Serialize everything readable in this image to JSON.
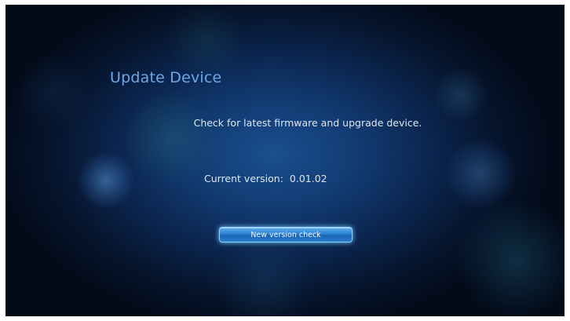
{
  "screen": {
    "title": "Update Device",
    "description": "Check for latest firmware and upgrade device.",
    "version_label": "Current version:",
    "version_value": "0.01.02",
    "check_button_label": "New version check"
  },
  "colors": {
    "title": "#6fa6e6",
    "text": "#dde6f2",
    "button": "#2f84d2",
    "background": "#0b2650"
  }
}
